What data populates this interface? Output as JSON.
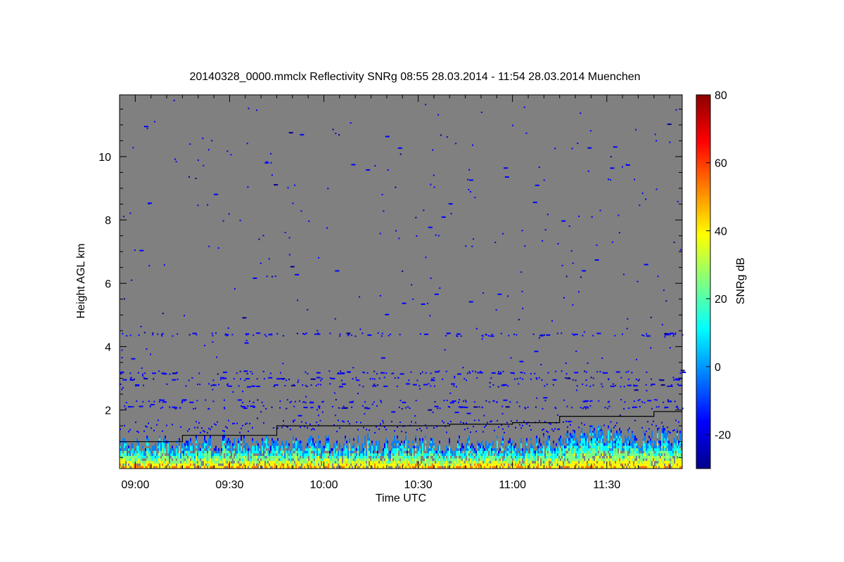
{
  "chart_data": {
    "type": "heatmap",
    "title": "20140328_0000.mmclx Reflectivity SNRg   08:55 28.03.2014 - 11:54 28.03.2014 Muenchen",
    "xlabel": "Time UTC",
    "ylabel": "Height AGL km",
    "x_ticks": [
      "09:00",
      "09:30",
      "10:00",
      "10:30",
      "11:00",
      "11:30"
    ],
    "xlim_minutes": [
      535,
      714
    ],
    "x_tick_minutes": [
      540,
      570,
      600,
      630,
      660,
      690
    ],
    "ylim": [
      0.15,
      11.95
    ],
    "y_ticks": [
      2,
      4,
      6,
      8,
      10
    ],
    "colorbar": {
      "label": "SNRg dB",
      "range": [
        -30,
        80
      ],
      "ticks": [
        -20,
        0,
        20,
        40,
        60,
        80
      ],
      "colormap": [
        "#00008c",
        "#0000ff",
        "#0080ff",
        "#00ffff",
        "#80ff80",
        "#ffff00",
        "#ff8000",
        "#ff0000",
        "#8c0000"
      ]
    },
    "background_color": "#808080",
    "boundary_line": {
      "description_free": true,
      "x_minutes": [
        535,
        555,
        555,
        565,
        565,
        585,
        585,
        615,
        615,
        640,
        640,
        660,
        660,
        675,
        675,
        690,
        690,
        705,
        705,
        714
      ],
      "y_km": [
        1.0,
        1.0,
        1.2,
        1.2,
        1.2,
        1.2,
        1.5,
        1.5,
        1.5,
        1.5,
        1.55,
        1.55,
        1.6,
        1.6,
        1.8,
        1.8,
        1.8,
        1.8,
        1.95,
        1.95
      ]
    }
  }
}
